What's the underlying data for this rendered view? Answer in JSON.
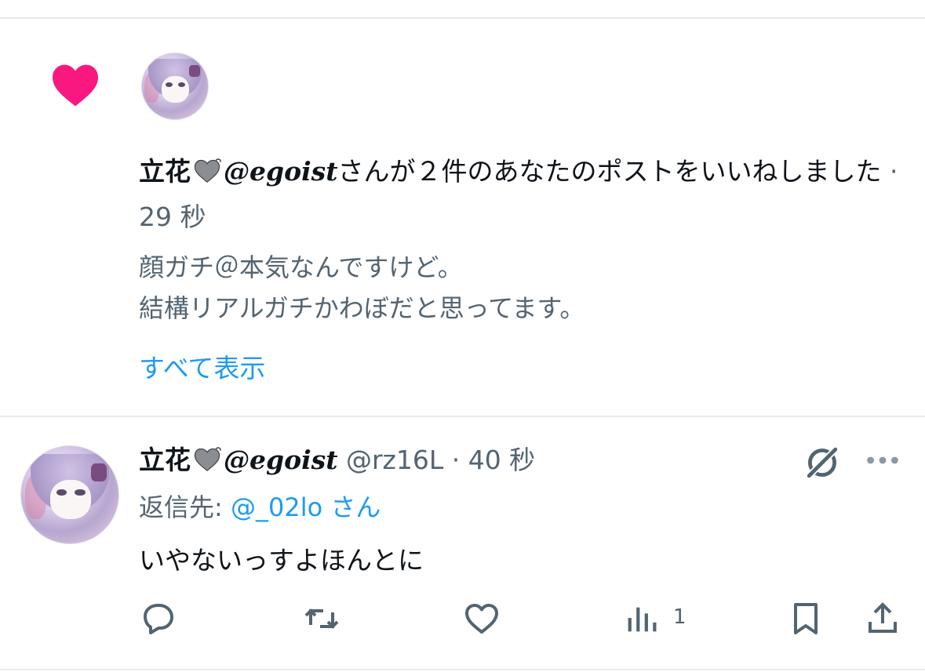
{
  "colors": {
    "like_heart": "#f91880",
    "link": "#1d9bf0",
    "secondary_text": "#536471",
    "primary_text": "#0f1419",
    "divider": "#e7e9ea"
  },
  "notification": {
    "icon": "heart-icon",
    "user_name": "立花",
    "user_handle_display": "@egoist",
    "action_text": "さんが２件のあなたのポストをいいねしました",
    "separator": " · ",
    "time": "29 秒",
    "preview_line1": "顔ガチ＠本気なんですけど。",
    "preview_line2": "結構リアルガチかわぼだと思ってます。",
    "show_all": "すべて表示"
  },
  "post": {
    "user_name": "立花",
    "user_handle_display": "@egoist",
    "username": "@rz16L",
    "separator": " · ",
    "time": "40 秒",
    "reply_label": "返信先: ",
    "reply_to": "@_02lo さん",
    "text": "いやないっすよほんとに",
    "views_count": "1",
    "icons": {
      "grok": "grok-icon",
      "more": "more-icon",
      "reply": "reply-icon",
      "repost": "repost-icon",
      "like": "like-icon",
      "views": "views-icon",
      "bookmark": "bookmark-icon",
      "share": "share-icon"
    }
  }
}
